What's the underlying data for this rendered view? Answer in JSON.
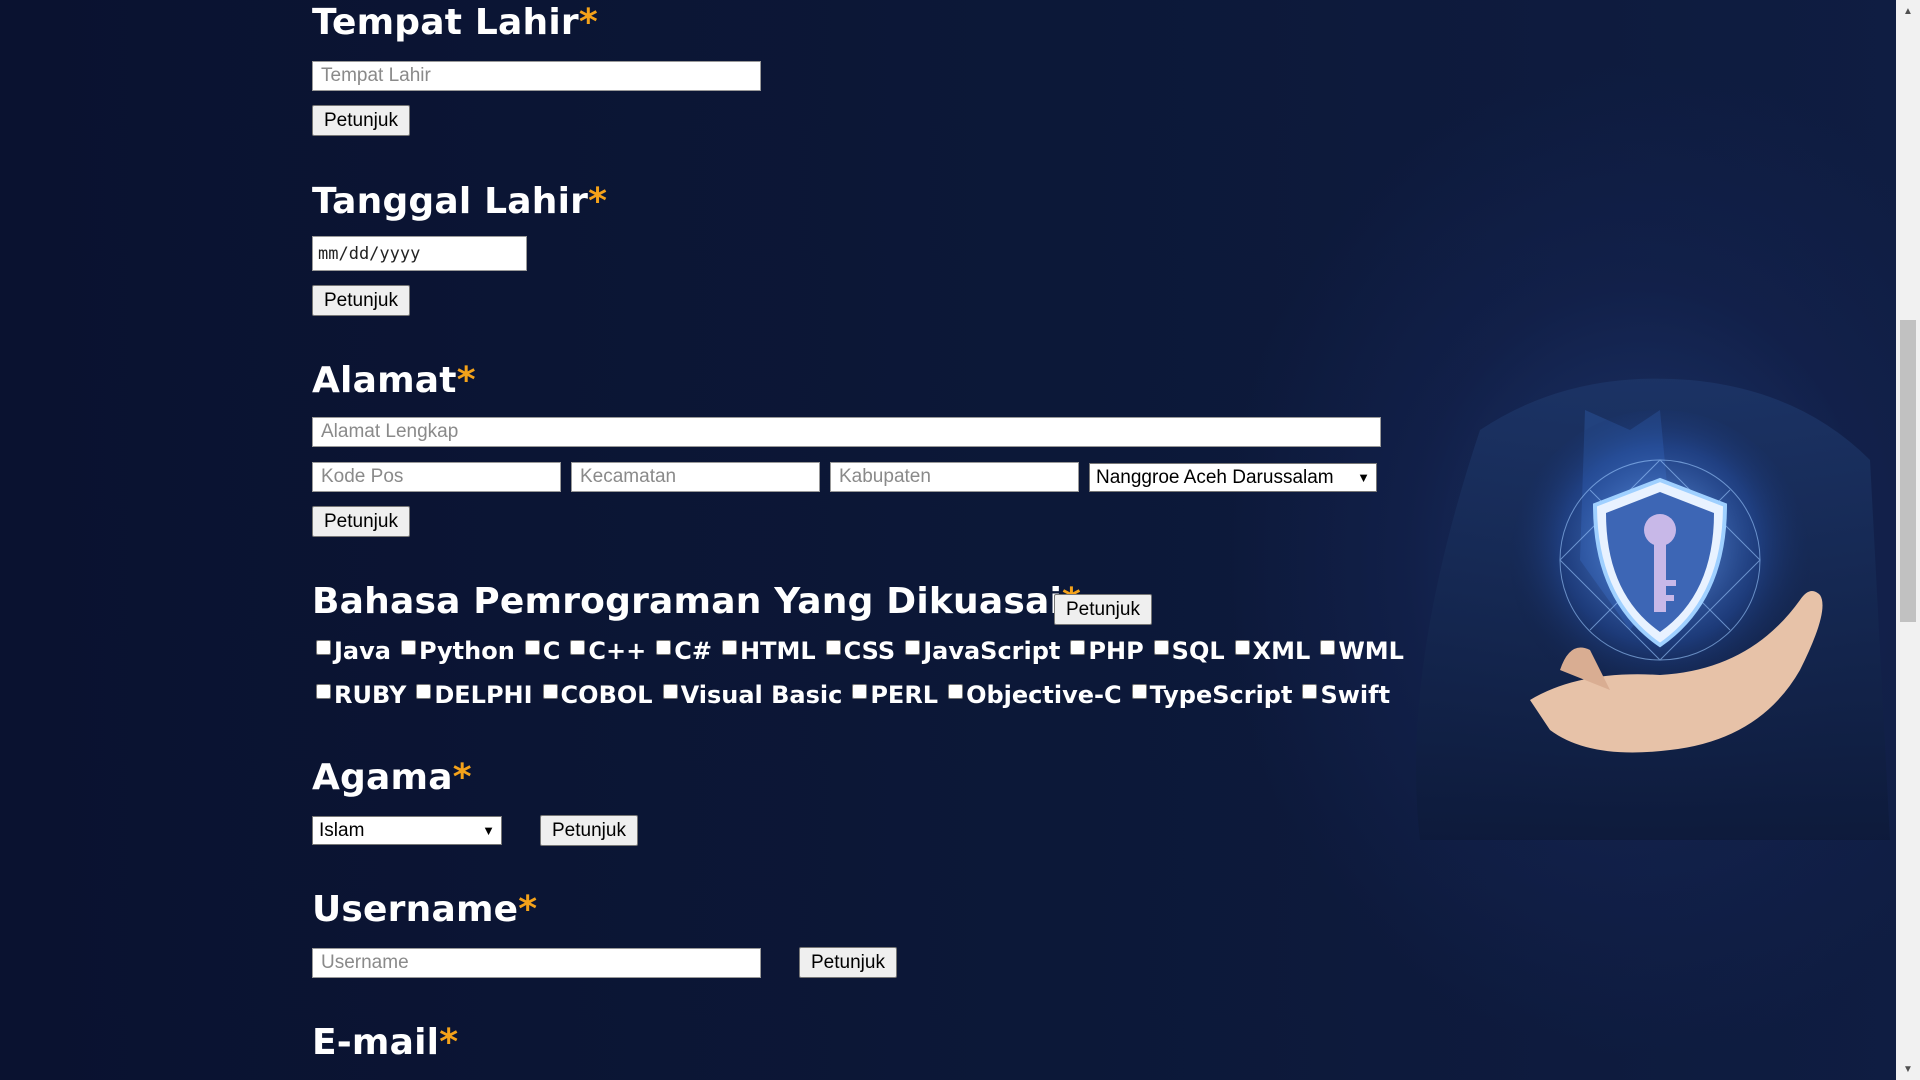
{
  "form": {
    "hint_button_label": "Petunjuk",
    "required_mark": "*",
    "tempat_lahir": {
      "label": "Tempat Lahir",
      "placeholder": "Tempat Lahir",
      "value": ""
    },
    "tanggal_lahir": {
      "label": "Tanggal Lahir",
      "date_placeholder": "mm/dd/yyyy"
    },
    "alamat": {
      "label": "Alamat",
      "full_placeholder": "Alamat Lengkap",
      "kode_pos_placeholder": "Kode Pos",
      "kecamatan_placeholder": "Kecamatan",
      "kabupaten_placeholder": "Kabupaten",
      "province_selected": "Nanggroe Aceh Darussalam"
    },
    "bahasa": {
      "label": "Bahasa Pemrograman Yang Dikuasai",
      "row1": [
        "Java",
        "Python",
        "C",
        "C++",
        "C#",
        "HTML",
        "CSS",
        "JavaScript",
        "PHP",
        "SQL",
        "XML",
        "WML"
      ],
      "row2": [
        "RUBY",
        "DELPHI",
        "COBOL",
        "Visual Basic",
        "PERL",
        "Objective-C",
        "TypeScript",
        "Swift"
      ]
    },
    "agama": {
      "label": "Agama",
      "selected": "Islam"
    },
    "username": {
      "label": "Username",
      "placeholder": "Username"
    },
    "email": {
      "label": "E-mail"
    }
  },
  "colors": {
    "background": "#0b1430",
    "required_asterisk": "#f4a21a"
  },
  "decor": {
    "illustration": "hand-holding-shield-key-icon"
  }
}
